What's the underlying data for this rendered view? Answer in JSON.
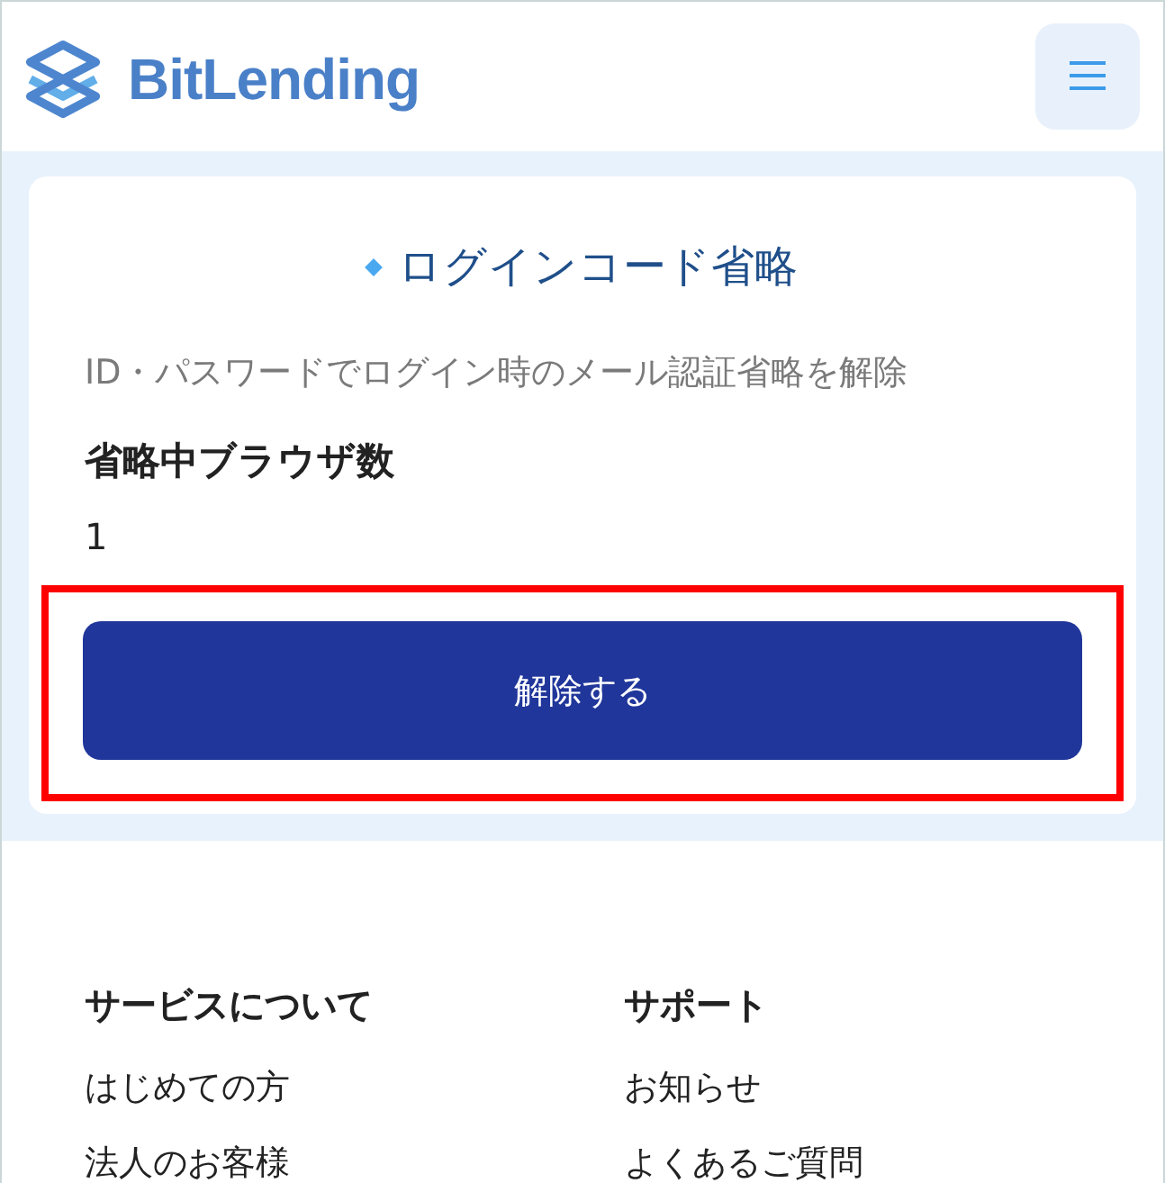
{
  "header": {
    "logo": "BitLending"
  },
  "card": {
    "title": "ログインコード省略",
    "description": "ID・パスワードでログイン時のメール認証省略を解除",
    "field_label": "省略中ブラウザ数",
    "field_value": "1",
    "button": {
      "label": "解除する",
      "highlighted": true
    }
  },
  "footer": {
    "columns": [
      {
        "heading": "サービスについて",
        "links": [
          "はじめての方",
          "法人のお客様"
        ]
      },
      {
        "heading": "サポート",
        "links": [
          "お知らせ",
          "よくあるご質問"
        ]
      }
    ]
  }
}
